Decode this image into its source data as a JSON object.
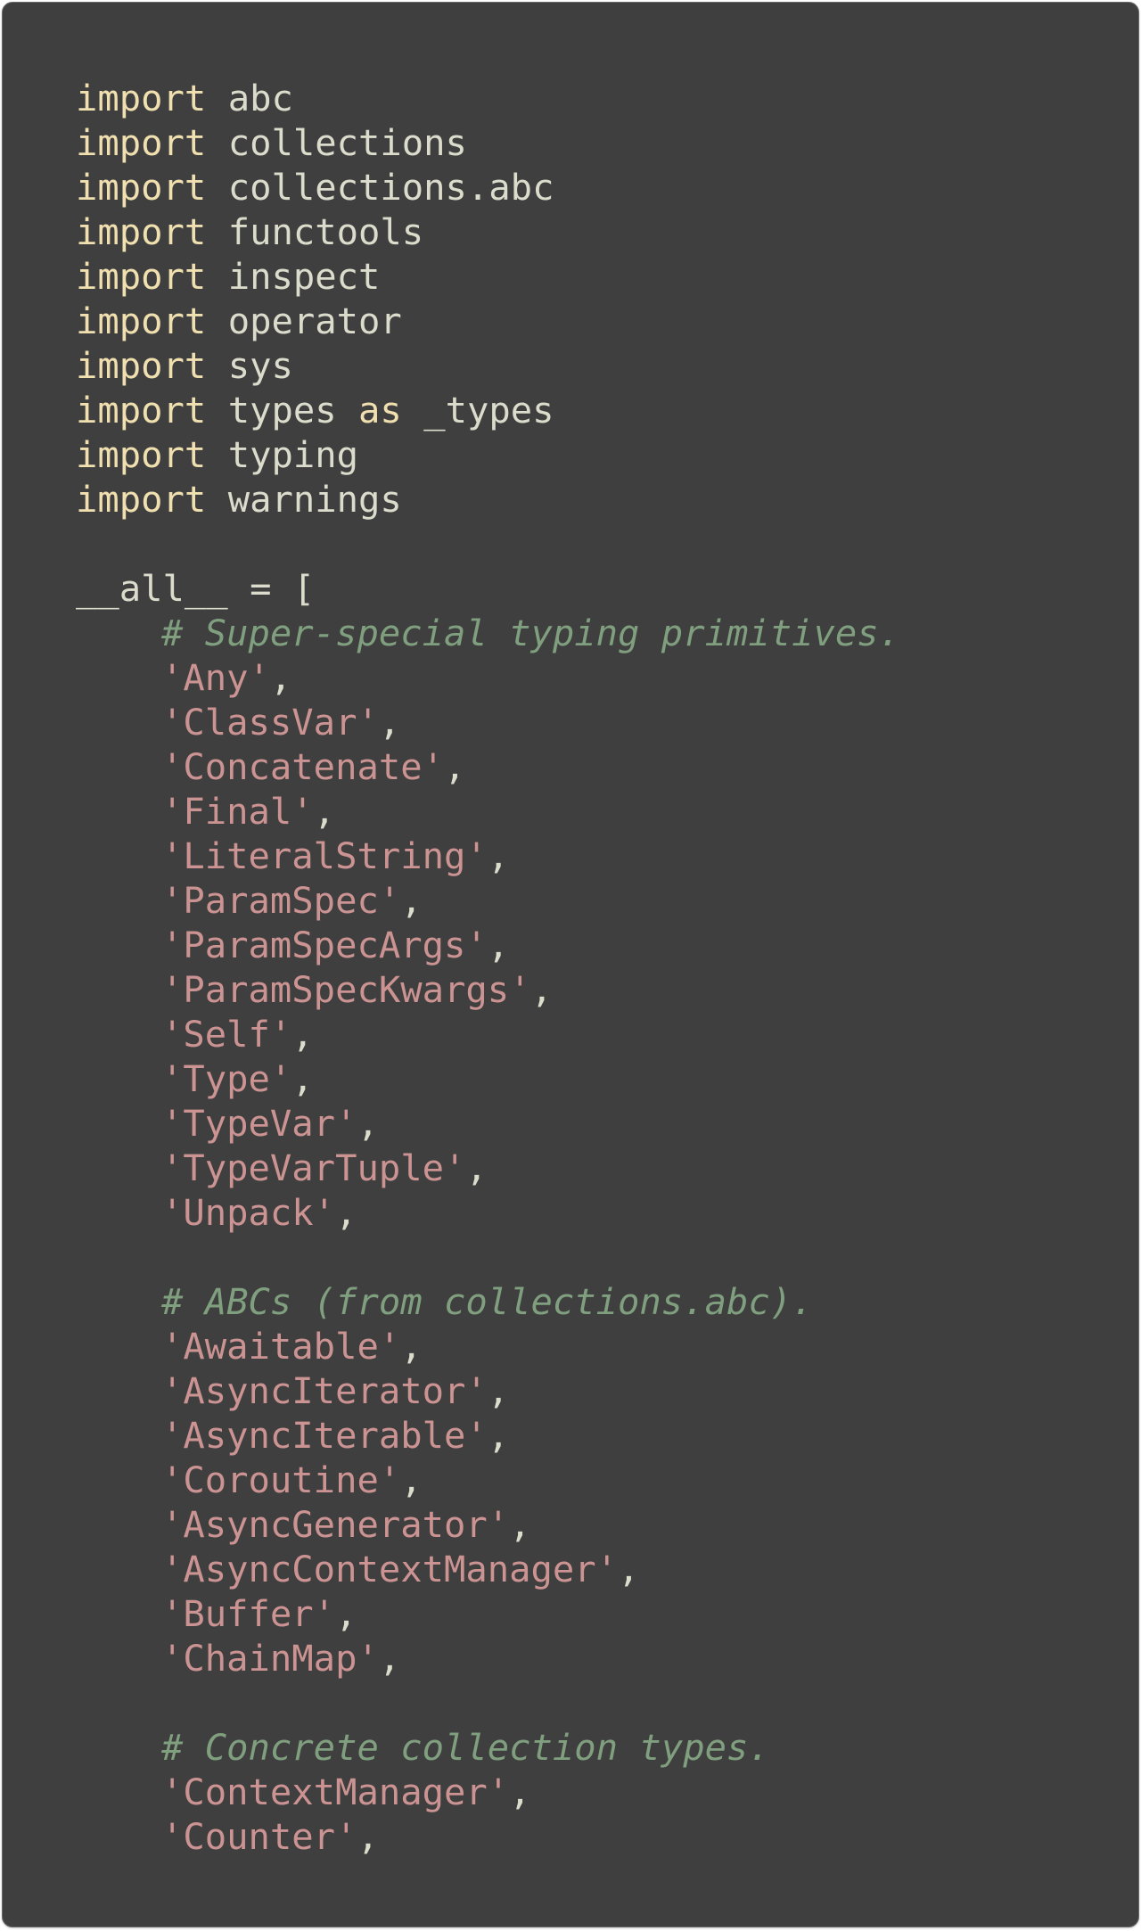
{
  "colors": {
    "background": "#3f3f3f",
    "keyword": "#f0dfaf",
    "identifier": "#dcdccc",
    "string": "#cc9393",
    "comment": "#7f9f7f"
  },
  "imports": [
    {
      "keyword": "import",
      "module": "abc"
    },
    {
      "keyword": "import",
      "module": "collections"
    },
    {
      "keyword": "import",
      "module": "collections.abc"
    },
    {
      "keyword": "import",
      "module": "functools"
    },
    {
      "keyword": "import",
      "module": "inspect"
    },
    {
      "keyword": "import",
      "module": "operator"
    },
    {
      "keyword": "import",
      "module": "sys"
    },
    {
      "keyword": "import",
      "module": "types",
      "as_keyword": "as",
      "alias": "_types"
    },
    {
      "keyword": "import",
      "module": "typing"
    },
    {
      "keyword": "import",
      "module": "warnings"
    }
  ],
  "all_decl": {
    "name": "__all__",
    "operator": "=",
    "open": "["
  },
  "sections": [
    {
      "comment": "# Super-special typing primitives.",
      "items": [
        "'Any'",
        "'ClassVar'",
        "'Concatenate'",
        "'Final'",
        "'LiteralString'",
        "'ParamSpec'",
        "'ParamSpecArgs'",
        "'ParamSpecKwargs'",
        "'Self'",
        "'Type'",
        "'TypeVar'",
        "'TypeVarTuple'",
        "'Unpack'"
      ]
    },
    {
      "comment": "# ABCs (from collections.abc).",
      "items": [
        "'Awaitable'",
        "'AsyncIterator'",
        "'AsyncIterable'",
        "'Coroutine'",
        "'AsyncGenerator'",
        "'AsyncContextManager'",
        "'Buffer'",
        "'ChainMap'"
      ]
    },
    {
      "comment": "# Concrete collection types.",
      "items": [
        "'ContextManager'",
        "'Counter'"
      ]
    }
  ],
  "separator": ","
}
